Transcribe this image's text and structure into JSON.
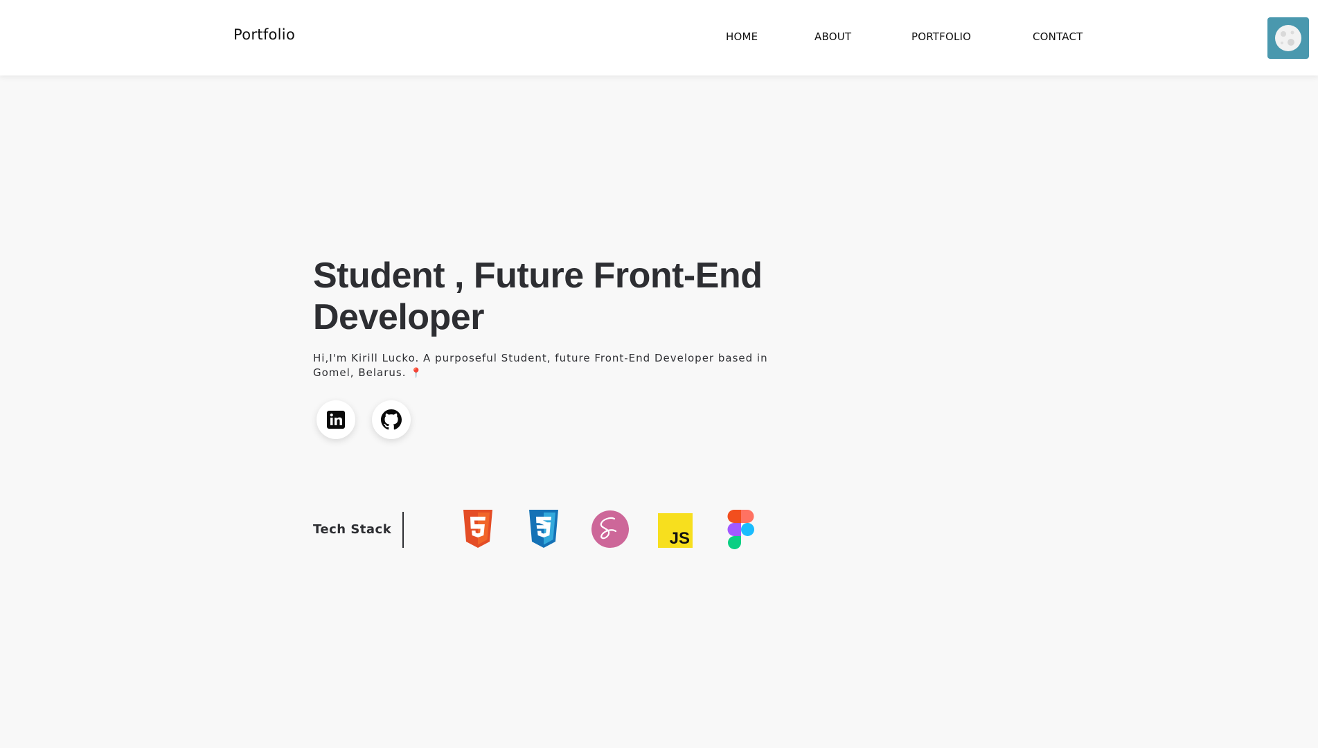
{
  "header": {
    "logo": "Portfolio",
    "nav": [
      "HOME",
      "ABOUT",
      "PORTFOLIO",
      "CONTACT"
    ],
    "theme_toggle_icon": "moon-icon"
  },
  "hero": {
    "title": "Student , Future Front-End Developer",
    "subtitle": "Hi,I'm Kirill Lucko. A purposeful Student, future Front-End Developer based in Gomel, Belarus.",
    "pin_icon": "📍",
    "social": [
      "linkedin-icon",
      "github-icon"
    ]
  },
  "tech_stack": {
    "label": "Tech Stack",
    "icons": [
      "html5-icon",
      "css3-icon",
      "sass-icon",
      "javascript-icon",
      "figma-icon"
    ],
    "js_text": "JS"
  },
  "colors": {
    "background": "#f8f8f8",
    "header_bg": "#ffffff",
    "text": "#2d2e32",
    "theme_button": "#4a98ae",
    "html5": "#e44d26",
    "css3": "#1572b6",
    "sass": "#cd6799",
    "javascript": "#f7df1e"
  }
}
